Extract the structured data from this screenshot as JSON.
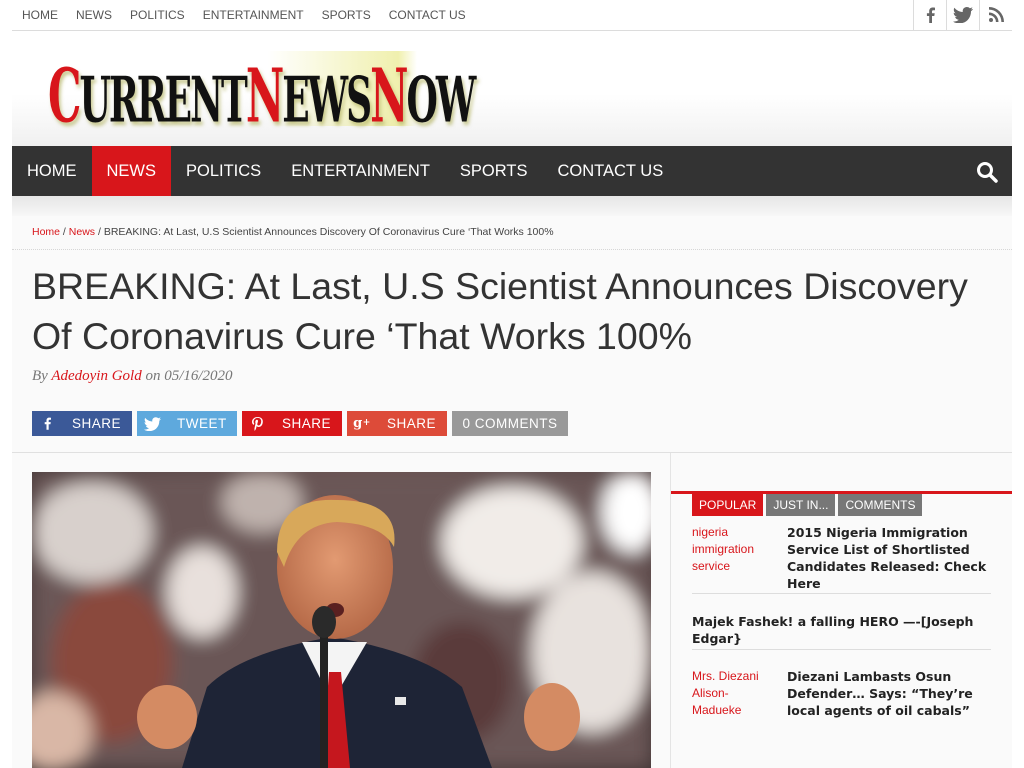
{
  "topbar": {
    "links": [
      "HOME",
      "NEWS",
      "POLITICS",
      "ENTERTAINMENT",
      "SPORTS",
      "CONTACT US"
    ],
    "social_icons": [
      "facebook-icon",
      "twitter-icon",
      "rss-icon"
    ]
  },
  "logo": {
    "text": "CurrentNewsNow",
    "colors": {
      "text": "#111111",
      "accent": "#d8161b"
    }
  },
  "mainnav": {
    "items": [
      "HOME",
      "NEWS",
      "POLITICS",
      "ENTERTAINMENT",
      "SPORTS",
      "CONTACT US"
    ],
    "active": "NEWS",
    "search_icon": "search-icon"
  },
  "breadcrumb": {
    "home": "Home",
    "sep1": " / ",
    "section": "News",
    "sep2": " / ",
    "current": "BREAKING: At Last, U.S Scientist Announces Discovery Of Coronavirus Cure ‘That Works 100%"
  },
  "article": {
    "title": "BREAKING: At Last, U.S Scientist Announces Discovery Of Coronavirus Cure ‘That Works 100%",
    "by_label": "By",
    "author": "Adedoyin Gold",
    "on_label": "on",
    "date": "05/16/2020"
  },
  "share": {
    "facebook": "SHARE",
    "twitter": "TWEET",
    "pinterest": "SHARE",
    "googleplus": "SHARE",
    "comments": "0 COMMENTS"
  },
  "sidebar": {
    "tabs": [
      "POPULAR",
      "JUST IN...",
      "COMMENTS"
    ],
    "items": [
      {
        "thumb_alt": "nigeria immigration service",
        "title": "2015 Nigeria Immigration Service List of Shortlisted Candidates Released: Check Here"
      },
      {
        "title": "Majek Fashek! a falling HERO —-[Joseph Edgar}"
      },
      {
        "thumb_alt": "Mrs. Diezani Alison-Madueke",
        "title": "Diezani Lambasts Osun Defender… Says: “They’re local agents of oil cabals”"
      }
    ]
  },
  "colors": {
    "brand_red": "#d8161b",
    "nav_dark": "#333333",
    "facebook": "#3b5998",
    "twitter": "#5ea9dd",
    "comments_gray": "#999999"
  }
}
